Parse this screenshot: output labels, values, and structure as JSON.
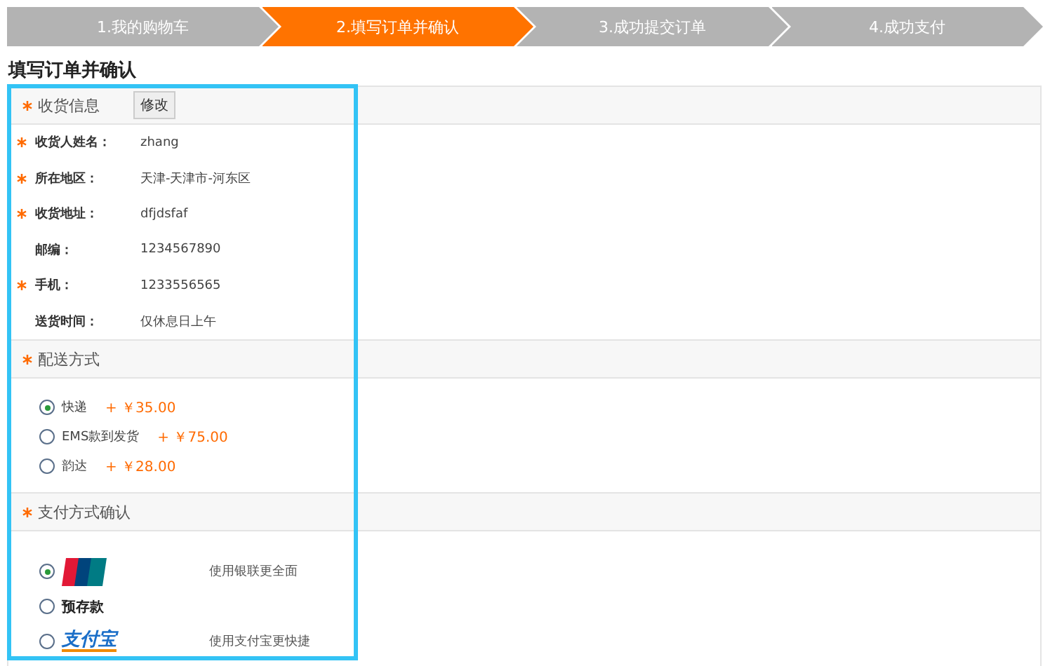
{
  "steps": [
    {
      "label": "1.我的购物车",
      "selected": false
    },
    {
      "label": "2.填写订单并确认",
      "selected": true
    },
    {
      "label": "3.成功提交订单",
      "selected": false
    },
    {
      "label": "4.成功支付",
      "selected": false
    }
  ],
  "page_title": "填写订单并确认",
  "shipping_info": {
    "title": "收货信息",
    "edit_button": "修改",
    "rows": [
      {
        "label": "收货人姓名：",
        "value": "zhang",
        "required": true
      },
      {
        "label": "所在地区：",
        "value": "天津-天津市-河东区",
        "required": true
      },
      {
        "label": "收货地址：",
        "value": "dfjdsfaf",
        "required": true
      },
      {
        "label": "邮编：",
        "value": "1234567890",
        "required": false
      },
      {
        "label": "手机：",
        "value": "1233556565",
        "required": true
      },
      {
        "label": "送货时间：",
        "value": "仅休息日上午",
        "required": false
      }
    ]
  },
  "delivery": {
    "title": "配送方式",
    "options": [
      {
        "label": "快递",
        "price": "+ ￥35.00",
        "selected": true
      },
      {
        "label": "EMS款到发货",
        "price": "+ ￥75.00",
        "selected": false
      },
      {
        "label": "韵达",
        "price": "+ ￥28.00",
        "selected": false
      }
    ]
  },
  "payment": {
    "title": "支付方式确认",
    "options": [
      {
        "kind": "unionpay",
        "note": "使用银联更全面",
        "selected": true
      },
      {
        "kind": "text",
        "label": "预存款",
        "selected": false
      },
      {
        "kind": "alipay",
        "label": "支付宝",
        "note": "使用支付宝更快捷",
        "selected": false
      }
    ]
  }
}
